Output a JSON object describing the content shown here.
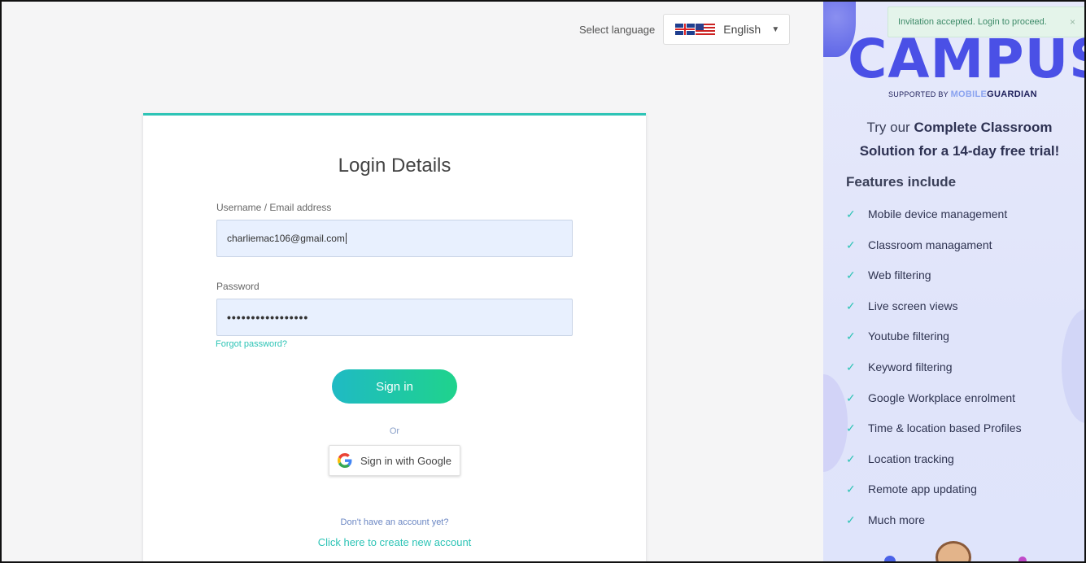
{
  "language": {
    "label": "Select language",
    "selected": "English",
    "flag_icons": [
      "uk-flag-icon",
      "us-flag-icon"
    ]
  },
  "login": {
    "title": "Login Details",
    "username_label": "Username / Email address",
    "username_value": "charliemac106@gmail.com",
    "password_label": "Password",
    "password_value": "•••••••••••••••••",
    "forgot_password": "Forgot password?",
    "sign_in": "Sign in",
    "or": "Or",
    "google_sign_in": "Sign in with Google",
    "no_account": "Don't have an account yet?",
    "create_account": "Click here to create new account"
  },
  "toast": {
    "message": "Invitation accepted. Login to proceed.",
    "close": "×"
  },
  "promo": {
    "logo": "CAMPUS",
    "supported_prefix": "SUPPORTED BY ",
    "supported_brand_1": "MOBILE",
    "supported_brand_2": "GUARDIAN",
    "headline_1": "Try our ",
    "headline_bold": "Complete Classroom",
    "headline_2": "Solution for a 14-day free trial!",
    "features_title": "Features include",
    "features": [
      "Mobile device management",
      "Classroom managament",
      "Web filtering",
      "Live screen views",
      "Youtube filtering",
      "Keyword filtering",
      "Google Workplace enrolment",
      "Time & location based Profiles",
      "Location tracking",
      "Remote app updating",
      "Much more"
    ],
    "check_glyph": "✓"
  },
  "colors": {
    "accent": "#2ec4b6",
    "brand": "#4a50e6",
    "toast_bg": "#e4f4ea"
  }
}
